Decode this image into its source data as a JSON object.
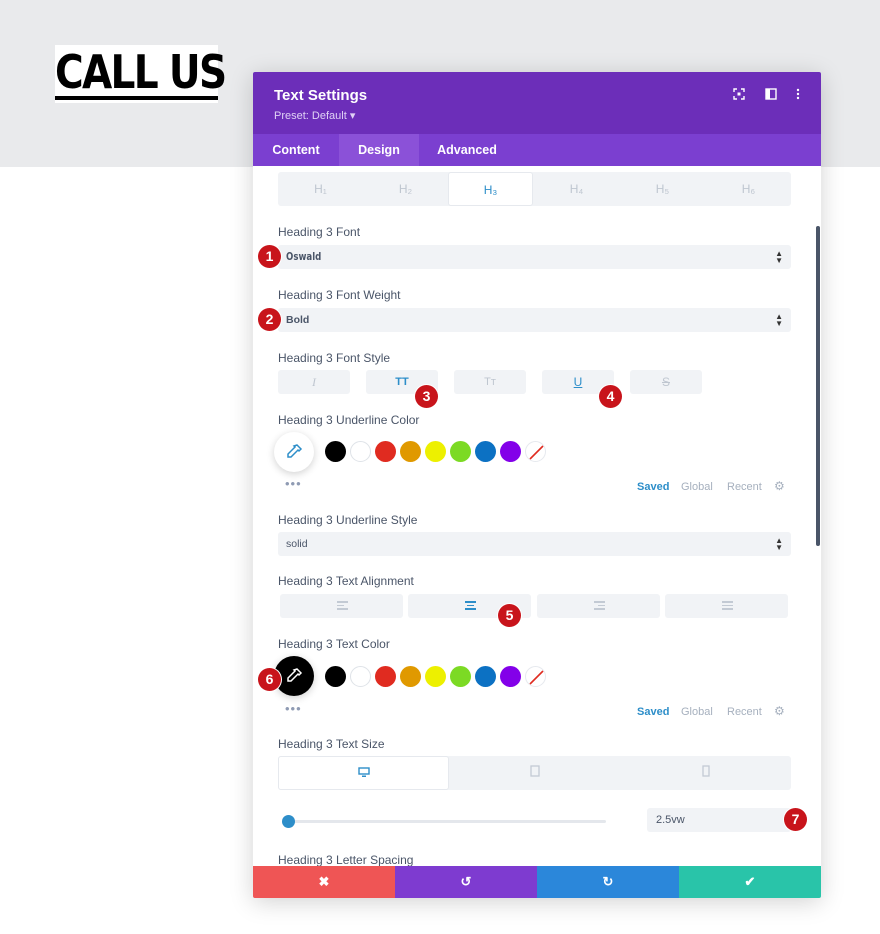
{
  "page": {
    "heading": "CALL US"
  },
  "modal": {
    "title": "Text Settings",
    "preset": "Preset: Default ▾",
    "header_icons": [
      "fullscreen-icon",
      "split-view-icon",
      "more-vertical-icon"
    ],
    "tabs": [
      {
        "label": "Content"
      },
      {
        "label": "Design"
      },
      {
        "label": "Advanced"
      }
    ],
    "active_tab": "Design"
  },
  "heading_tabs": [
    {
      "label": "H₁"
    },
    {
      "label": "H₂"
    },
    {
      "label": "H₃"
    },
    {
      "label": "H₄"
    },
    {
      "label": "H₅"
    },
    {
      "label": "H₆"
    }
  ],
  "active_heading_tab": "H₃",
  "fields": {
    "font": {
      "label": "Heading 3 Font",
      "value": "Oswald"
    },
    "font_weight": {
      "label": "Heading 3 Font Weight",
      "value": "Bold"
    },
    "font_style": {
      "label": "Heading 3 Font Style",
      "buttons": [
        {
          "glyph": "I",
          "active": false
        },
        {
          "glyph": "TT",
          "active": true
        },
        {
          "glyph": "Tт",
          "active": false
        },
        {
          "glyph": "U",
          "active": true
        },
        {
          "glyph": "S",
          "active": false
        }
      ]
    },
    "underline_color": {
      "label": "Heading 3 Underline Color"
    },
    "underline_style": {
      "label": "Heading 3 Underline Style",
      "value": "solid"
    },
    "text_alignment": {
      "label": "Heading 3 Text Alignment",
      "active_index": 1
    },
    "text_color": {
      "label": "Heading 3 Text Color"
    },
    "text_size": {
      "label": "Heading 3 Text Size",
      "value": "2.5vw",
      "slider_fraction": 0.0
    },
    "letter_spacing": {
      "label": "Heading 3 Letter Spacing"
    }
  },
  "color_swatches": [
    "#000000",
    "#ffffff",
    "#e02b20",
    "#e09900",
    "#edf000",
    "#7cda24",
    "#0c71c3",
    "#8300e9"
  ],
  "color_tabs": {
    "saved": "Saved",
    "global": "Global",
    "recent": "Recent"
  },
  "more_dots": "•••",
  "badges": [
    "1",
    "2",
    "3",
    "4",
    "5",
    "6",
    "7"
  ],
  "footer": {
    "cancel_icon": "✖",
    "undo_icon": "↺",
    "redo_icon": "↻",
    "save_icon": "✔",
    "colors": {
      "cancel": "#ef5555",
      "undo": "#7e3bd0",
      "redo": "#2b87da",
      "save": "#29c4a9"
    }
  },
  "colors": {
    "header": "#6c2eb9",
    "tabs": "#7b3fd0",
    "accent": "#2d8ec9",
    "badge": "#c8141b"
  }
}
